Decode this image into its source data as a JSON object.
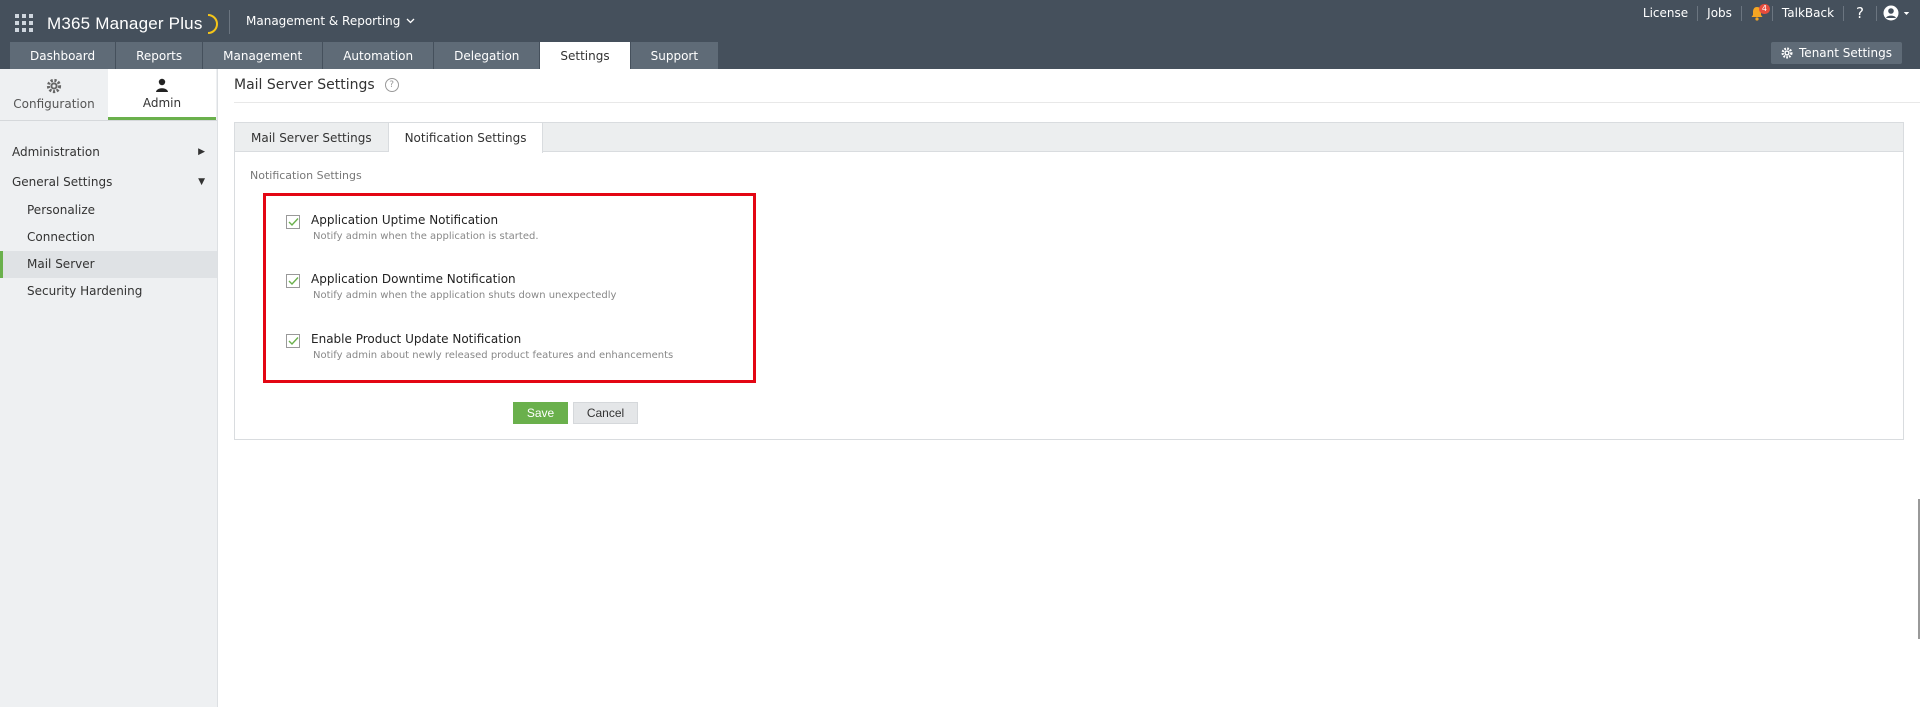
{
  "app": {
    "name": "M365 Manager Plus",
    "module_switch": "Management & Reporting"
  },
  "topbar": {
    "links": {
      "license": "License",
      "jobs": "Jobs",
      "talkback": "TalkBack",
      "help": "?"
    },
    "notification_count": "4",
    "tabs": [
      {
        "label": "Dashboard"
      },
      {
        "label": "Reports"
      },
      {
        "label": "Management"
      },
      {
        "label": "Automation"
      },
      {
        "label": "Delegation"
      },
      {
        "label": "Settings"
      },
      {
        "label": "Support"
      }
    ],
    "active_tab": "Settings",
    "tenant_settings_label": "Tenant Settings"
  },
  "sidebar": {
    "top_tabs": [
      {
        "label": "Configuration",
        "icon": "gear-icon"
      },
      {
        "label": "Admin",
        "icon": "user-icon"
      }
    ],
    "active_top_tab": "Admin",
    "groups": [
      {
        "label": "Administration",
        "expanded": false
      },
      {
        "label": "General Settings",
        "expanded": true
      }
    ],
    "sub_items": [
      {
        "label": "Personalize"
      },
      {
        "label": "Connection"
      },
      {
        "label": "Mail Server"
      },
      {
        "label": "Security Hardening"
      }
    ],
    "active_sub_item": "Mail Server"
  },
  "main": {
    "page_title": "Mail Server Settings",
    "help_glyph": "?",
    "panel_tabs": [
      {
        "label": "Mail Server Settings"
      },
      {
        "label": "Notification Settings"
      }
    ],
    "active_panel_tab": "Notification Settings",
    "section_label": "Notification Settings",
    "options": [
      {
        "title": "Application Uptime Notification",
        "description": "Notify admin when the application is started.",
        "checked": true
      },
      {
        "title": "Application Downtime Notification",
        "description": "Notify admin when the application shuts down unexpectedly",
        "checked": true
      },
      {
        "title": "Enable Product Update Notification",
        "description": "Notify admin about newly released product features and enhancements",
        "checked": true
      }
    ],
    "save_label": "Save",
    "cancel_label": "Cancel"
  },
  "colors": {
    "topbar_bg": "#45505c",
    "accent_green": "#6ab04c",
    "highlight_red": "#e30613"
  }
}
